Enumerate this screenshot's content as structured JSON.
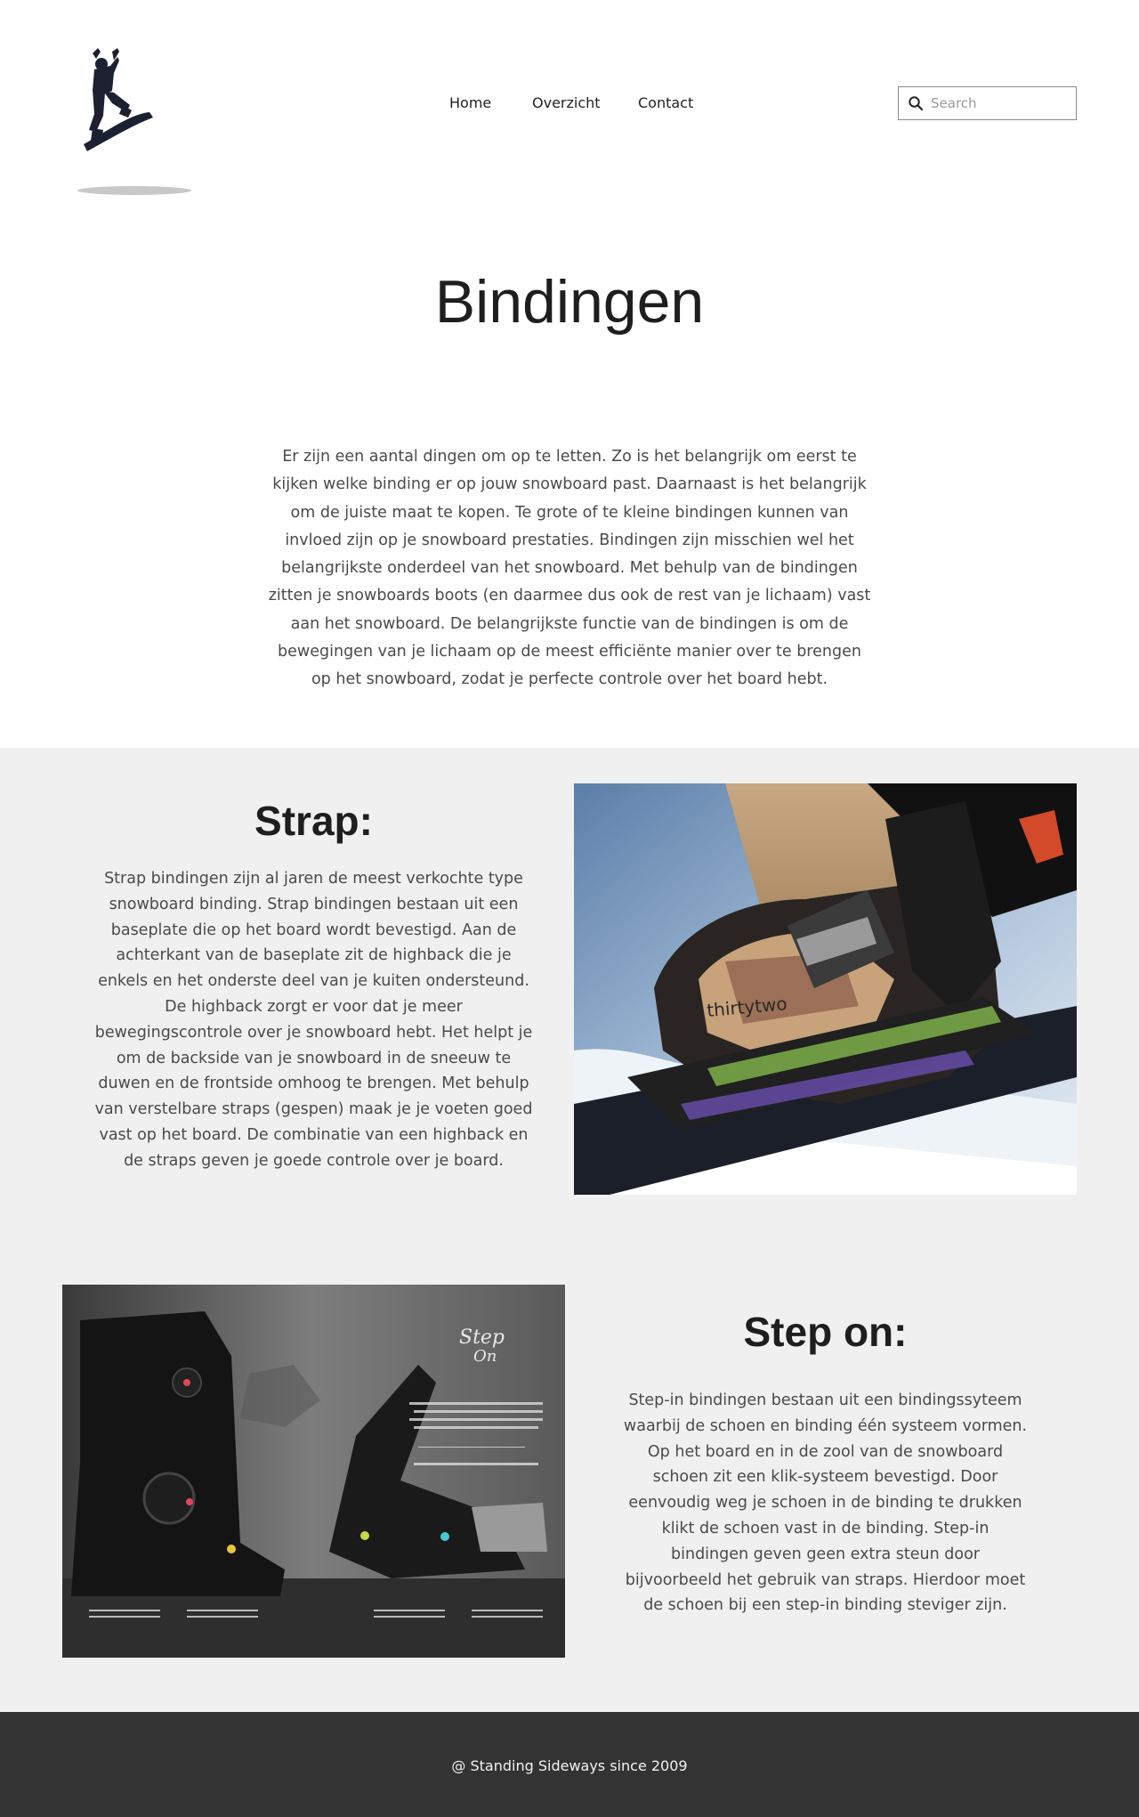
{
  "nav": {
    "items": [
      {
        "label": "Home"
      },
      {
        "label": "Overzicht"
      },
      {
        "label": "Contact"
      }
    ]
  },
  "search": {
    "placeholder": "Search",
    "value": ""
  },
  "page": {
    "title": "Bindingen",
    "intro": "Er zijn een aantal dingen om op te letten. Zo is het belangrijk om eerst te kijken welke binding er op jouw snowboard past. Daarnaast is het belangrijk om de juiste maat te kopen. Te grote of te kleine bindingen kunnen van invloed zijn op je snowboard prestaties. Bindingen zijn misschien wel het belangrijkste onderdeel van het snowboard. Met behulp van de bindingen zitten je snowboards boots (en daarmee dus ook de rest van je lichaam) vast aan het snowboard. De belangrijkste functie van de bindingen is om de bewegingen van je lichaam op de meest efficiënte manier over te brengen op het snowboard, zodat je perfecte controle over het board hebt."
  },
  "sections": {
    "strap": {
      "title": "Strap:",
      "text": "Strap bindingen zijn al jaren de meest verkochte type snowboard binding. Strap bindingen bestaan uit een baseplate die op het board wordt bevestigd. Aan de achterkant van de baseplate zit de highback die je enkels en het onderste deel van je kuiten ondersteund. De highback zorgt er voor dat je meer bewegingscontrole over je snowboard hebt. Het helpt je om de backside van je snowboard in de sneeuw te duwen en de frontside omhoog te brengen. Met behulp van verstelbare straps (gespen) maak je je voeten goed vast op het board. De combinatie van een highback en de straps geven je goede controle over je board.",
      "image_brand": "thirtytwo"
    },
    "stepon": {
      "title": "Step on:",
      "text": "Step-in bindingen bestaan uit een bindingssyteem waarbij de schoen en binding één systeem vormen. Op het board en in de zool van de snowboard schoen zit een klik-systeem bevestigd. Door eenvoudig weg je schoen in de binding te drukken klikt de schoen vast in de binding. Step-in bindingen geven geen extra steun door bijvoorbeeld het gebruik van straps. Hierdoor moet de schoen bij een step-in binding steviger zijn.",
      "image_logo_line1": "Step",
      "image_logo_line2": "On"
    }
  },
  "footer": {
    "text": "@ Standing Sideways since 2009"
  },
  "colors": {
    "footer_bg": "#333333",
    "section_bg": "#f0f0f0",
    "text": "#4a4a4a",
    "heading": "#1e1e1e"
  },
  "icons": {
    "logo": "snowboarder-logo",
    "search": "search-icon"
  }
}
